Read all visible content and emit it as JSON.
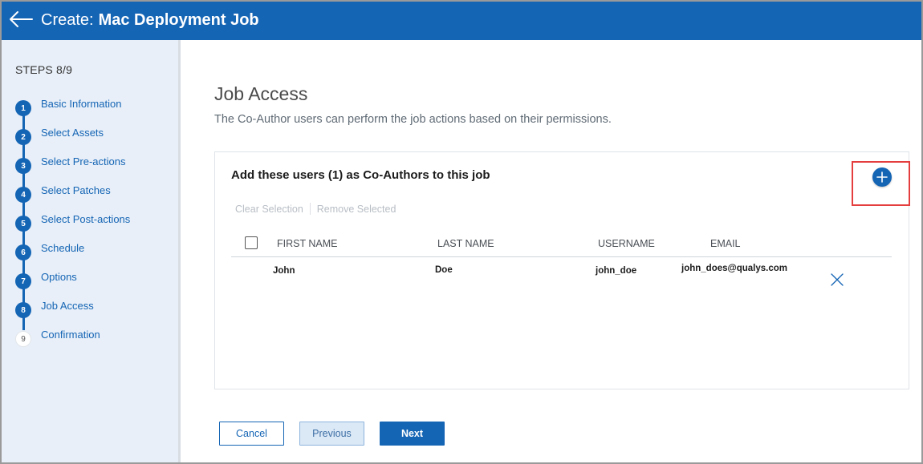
{
  "header": {
    "back_icon": "arrow-left-icon",
    "title_prefix": "Create:",
    "title_name": "Mac Deployment Job"
  },
  "sidebar": {
    "steps_label": "STEPS 8/9",
    "steps": [
      {
        "number": "1",
        "label": "Basic Information",
        "state": "completed"
      },
      {
        "number": "2",
        "label": "Select Assets",
        "state": "completed"
      },
      {
        "number": "3",
        "label": "Select Pre-actions",
        "state": "completed"
      },
      {
        "number": "4",
        "label": "Select Patches",
        "state": "completed"
      },
      {
        "number": "5",
        "label": "Select Post-actions",
        "state": "completed"
      },
      {
        "number": "6",
        "label": "Schedule",
        "state": "completed"
      },
      {
        "number": "7",
        "label": "Options",
        "state": "completed"
      },
      {
        "number": "8",
        "label": "Job Access",
        "state": "current"
      },
      {
        "number": "9",
        "label": "Confirmation",
        "state": "pending"
      }
    ]
  },
  "main": {
    "title": "Job Access",
    "description": "The Co-Author users can perform the job actions based on their permissions.",
    "card": {
      "title": "Add these users (1) as Co-Authors to this job",
      "add_icon": "plus-circle-icon",
      "actions": {
        "clear_selection": "Clear Selection",
        "remove_selected": "Remove Selected"
      },
      "columns": {
        "first_name": "FIRST NAME",
        "last_name": "LAST NAME",
        "username": "USERNAME",
        "email": "EMAIL"
      },
      "rows": [
        {
          "first_name": "John",
          "last_name": "Doe",
          "username": "john_doe",
          "email": "john_does@qualys.com",
          "remove_icon": "close-icon"
        }
      ]
    },
    "buttons": {
      "cancel": "Cancel",
      "previous": "Previous",
      "next": "Next"
    }
  },
  "colors": {
    "brand_blue": "#1565b5",
    "highlight_red": "#e53e3e",
    "sidebar_bg": "#e8eff8"
  }
}
